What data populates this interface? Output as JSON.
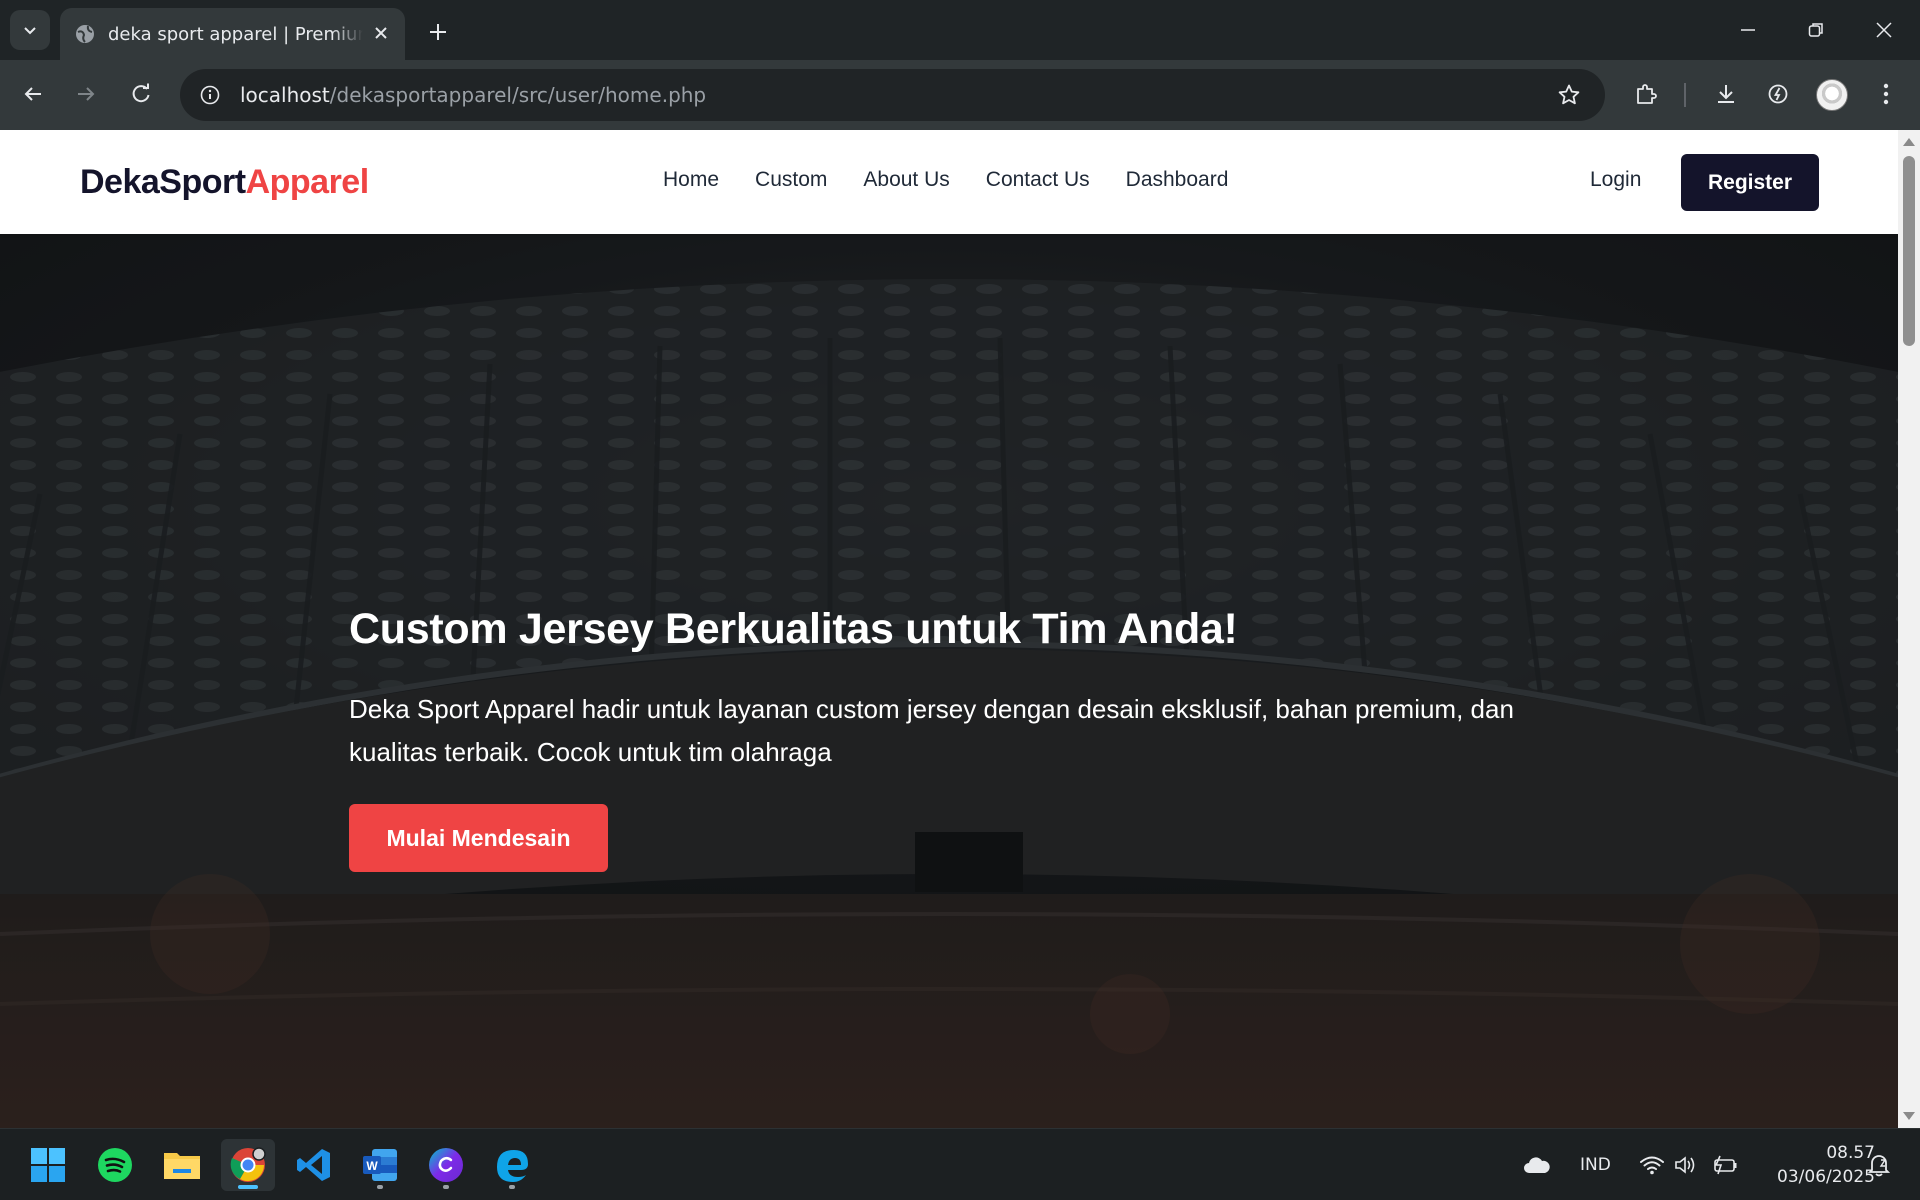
{
  "browser": {
    "tab_title": "deka sport apparel | Premium Custom Jersey",
    "url_host": "localhost",
    "url_path": "/dekasportapparel/src/user/home.php"
  },
  "site": {
    "brand_part1": "DekaSport",
    "brand_part2": "Apparel",
    "nav": [
      "Home",
      "Custom",
      "About Us",
      "Contact Us",
      "Dashboard"
    ],
    "login_label": "Login",
    "register_label": "Register"
  },
  "hero": {
    "title": "Custom Jersey Berkualitas untuk Tim Anda!",
    "description": "Deka Sport Apparel hadir untuk layanan custom jersey dengan desain eksklusif, bahan premium, dan kualitas terbaik. Cocok untuk tim olahraga",
    "cta_label": "Mulai Mendesain"
  },
  "taskbar": {
    "language": "IND",
    "time": "08.57",
    "date": "03/06/2025",
    "apps": [
      "windows-start-icon",
      "spotify-icon",
      "file-explorer-icon",
      "chrome-icon",
      "vscode-icon",
      "word-icon",
      "canva-icon",
      "edge-icon"
    ]
  },
  "colors": {
    "brand_dark": "#14142b",
    "brand_red": "#ef4444",
    "chrome_dark": "#33393b"
  }
}
